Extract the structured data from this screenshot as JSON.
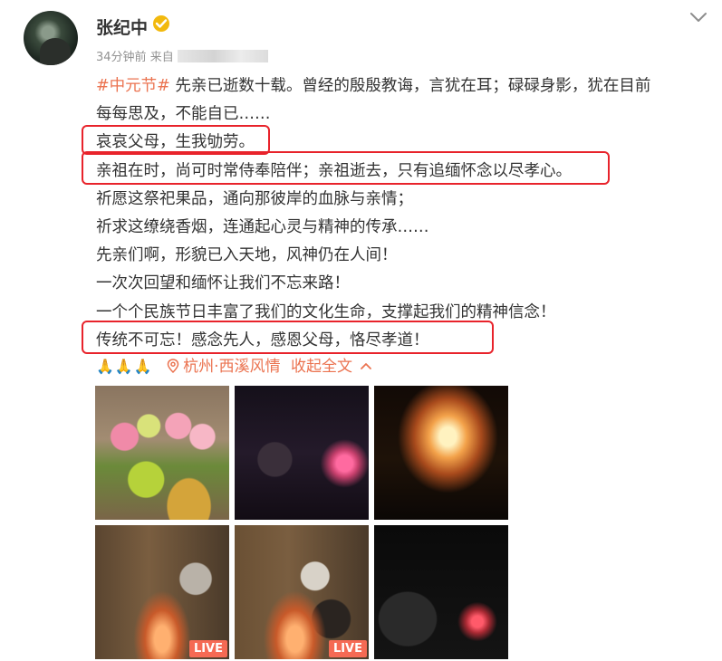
{
  "header": {
    "username": "张纪中",
    "time": "34分钟前",
    "source_prefix": "来自"
  },
  "post": {
    "lines": [
      {
        "hashtag": "#中元节#",
        "text": " 先亲已逝数十载。曾经的殷殷教诲，言犹在耳；碌碌身影，犹在目前"
      },
      {
        "hashtag": "",
        "text": "每每思及，不能自已……"
      },
      {
        "hashtag": "",
        "text": "哀哀父母，生我劬劳。"
      },
      {
        "hashtag": "",
        "text": "亲祖在时，尚可时常侍奉陪伴；亲祖逝去，只有追缅怀念以尽孝心。"
      },
      {
        "hashtag": "",
        "text": "祈愿这祭祀果品，通向那彼岸的血脉与亲情；"
      },
      {
        "hashtag": "",
        "text": "祈求这缭绕香烟，连通起心灵与精神的传承……"
      },
      {
        "hashtag": "",
        "text": "先亲们啊，形貌已入天地，风神仍在人间！"
      },
      {
        "hashtag": "",
        "text": "一次次回望和缅怀让我们不忘来路！"
      },
      {
        "hashtag": "",
        "text": "一个个民族节日丰富了我们的文化生命，支撑起我们的精神信念！"
      },
      {
        "hashtag": "",
        "text": "传统不可忘！感念先人，感恩父母，恪尽孝道！"
      }
    ],
    "emoji": "🙏🙏🙏",
    "location": "杭州·西溪风情",
    "collapse_label": "收起全文"
  },
  "images": [
    {
      "alt": "flowers and offerings",
      "badge": ""
    },
    {
      "alt": "lotus candle at night",
      "badge": ""
    },
    {
      "alt": "burning offerings",
      "badge": ""
    },
    {
      "alt": "elder burning paper",
      "badge": "LIVE"
    },
    {
      "alt": "elder and child burning paper",
      "badge": "LIVE"
    },
    {
      "alt": "dark scene with candle",
      "badge": ""
    }
  ],
  "colors": {
    "link": "#eb7350",
    "highlight": "#e8232b",
    "verified": "#f2b90d"
  },
  "icons": {
    "verified": "verified-badge-icon",
    "chevron": "chevron-down-icon",
    "location": "location-pin-icon",
    "collapse": "chevron-up-icon"
  }
}
